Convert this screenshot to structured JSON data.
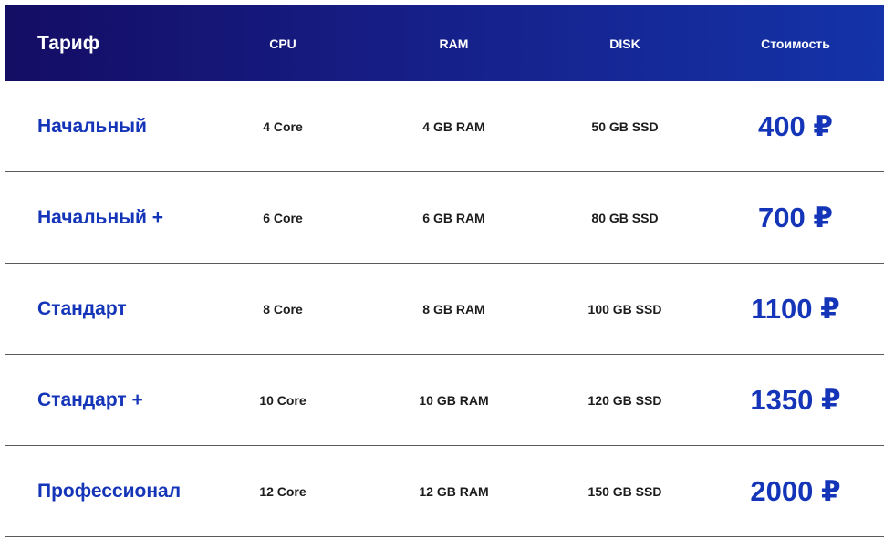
{
  "header": {
    "tariff": "Тариф",
    "cpu": "CPU",
    "ram": "RAM",
    "disk": "DISK",
    "price": "Стоимость"
  },
  "rows": [
    {
      "name": "Начальный",
      "cpu": "4 Core",
      "ram": "4 GB RAM",
      "disk": "50 GB SSD",
      "price": "400 ₽"
    },
    {
      "name": "Начальный +",
      "cpu": "6 Core",
      "ram": "6 GB RAM",
      "disk": "80 GB SSD",
      "price": "700 ₽"
    },
    {
      "name": "Стандарт",
      "cpu": "8 Core",
      "ram": "8 GB RAM",
      "disk": "100 GB SSD",
      "price": "1100 ₽"
    },
    {
      "name": "Стандарт +",
      "cpu": "10 Core",
      "ram": "10 GB RAM",
      "disk": "120 GB SSD",
      "price": "1350 ₽"
    },
    {
      "name": "Профессионал",
      "cpu": "12 Core",
      "ram": "12 GB RAM",
      "disk": "150 GB SSD",
      "price": "2000 ₽"
    }
  ],
  "colors": {
    "accent": "#1535b8",
    "header_start": "#140d64",
    "header_end": "#1433a8"
  }
}
